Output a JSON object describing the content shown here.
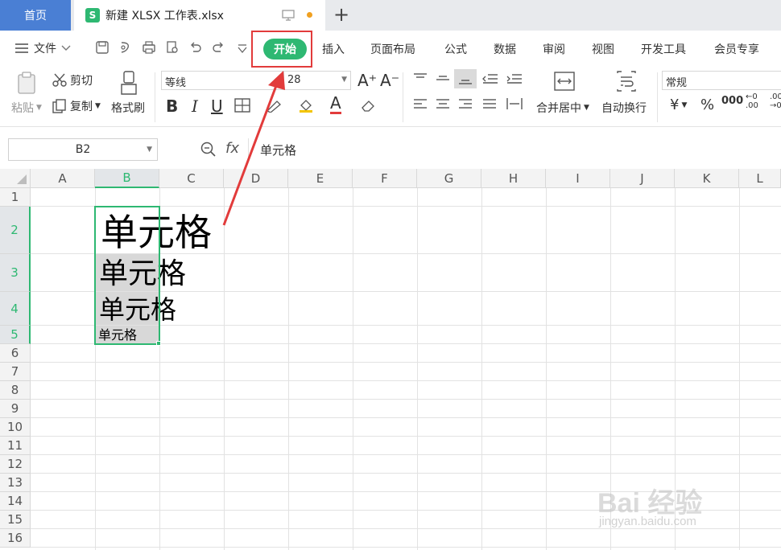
{
  "tabs": {
    "home_label": "首页",
    "doc_label": "新建 XLSX 工作表.xlsx",
    "doc_icon_letter": "S"
  },
  "menu": {
    "file_label": "文件",
    "items": [
      "开始",
      "插入",
      "页面布局",
      "公式",
      "数据",
      "审阅",
      "视图",
      "开发工具",
      "会员专享"
    ],
    "active": "开始"
  },
  "ribbon": {
    "paste": "粘贴",
    "cut": "剪切",
    "copy": "复制",
    "format_painter": "格式刷",
    "font_name": "等线",
    "font_size": "28",
    "merge_center": "合并居中",
    "wrap_text": "自动换行",
    "number_format": "常规"
  },
  "formula_bar": {
    "name_box": "B2",
    "fx_label": "fx",
    "value": "单元格"
  },
  "grid": {
    "columns": [
      "A",
      "B",
      "C",
      "D",
      "E",
      "F",
      "G",
      "H",
      "I",
      "J",
      "K",
      "L"
    ],
    "rows": [
      "1",
      "2",
      "3",
      "4",
      "5",
      "6",
      "7",
      "8",
      "9",
      "10",
      "11",
      "12",
      "13",
      "14",
      "15",
      "16"
    ],
    "selected_column": "B",
    "cells": [
      {
        "ref": "B2",
        "text": "单元格"
      },
      {
        "ref": "B3",
        "text": "单元格"
      },
      {
        "ref": "B4",
        "text": "单元格"
      },
      {
        "ref": "B5",
        "text": "单元格"
      }
    ]
  },
  "watermark": {
    "brand": "Bai 经验",
    "url": "jingyan.baidu.com"
  },
  "colors": {
    "accent_green": "#2eb872",
    "annotation_red": "#e23b3b",
    "home_tab_blue": "#4a7fd4"
  }
}
